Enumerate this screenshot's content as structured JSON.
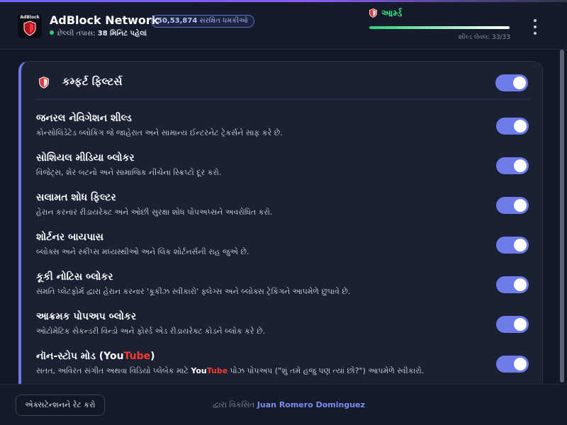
{
  "header": {
    "app_name": "AdBlock Network",
    "logo_text": "AdBlock",
    "blocked_count": "50,53,874",
    "blocked_label": "સંરક્ષિત ધમકીઓ",
    "last_check_label": "છેલ્લી તપાસ:",
    "last_check_value": "38 મિનિટ પહેલાં",
    "status": "આર્મ્ડ",
    "shield_level_text": "શીલ્ડ લેવલ: 33/33",
    "shield_level_fraction": 1.0,
    "colors": {
      "accent": "#6d7ce8",
      "armed": "#39e07f",
      "danger": "#e03a3a"
    }
  },
  "card": {
    "title": "કમ્ફર્ટ ફિલ્ટર્સ",
    "master_toggle_on": true,
    "filters": [
      {
        "title": "જનરલ નેવિગેશન શીલ્ડ",
        "description": "કોન્સોલિડેટેડ બ્લોકિંગ જે જાહેરાત અને સામાન્ય ઈન્ટરનેટ ટ્રેકર્સને સાફ કરે છે.",
        "enabled": true
      },
      {
        "title": "સોશિયલ મીડિયા બ્લોકર",
        "description": "વિજેટ્સ, શેર બટનો અને સામાજિક નીચેના સ્ક્રિપ્ટો દૂર કરો.",
        "enabled": true
      },
      {
        "title": "સલામત શોધ ફિલ્ટર",
        "description": "હેરાન કરનાર રીડાયરેક્ટ અને ઓછી સુરક્ષા શોધ પોપઅપ્સને અવરોધિત કરો.",
        "enabled": true
      },
      {
        "title": "શોર્ટનર બાયપાસ",
        "description": "બ્લોક્સ અને સ્કીપ્સ મધ્યસ્થીઓ અને લિંક શોર્ટનર્સની રાહ જુએ છે.",
        "enabled": true
      },
      {
        "title": "કૂકી નોટિસ બ્લોકર",
        "description": "સંમતિ પ્લેટફોર્મ દ્વારા હેરાન કરનાર 'કૂકીઝ સ્વીકારો' ફ્લેગ્સ અને બ્લોક્સ ટ્રેકિંગને આપમેળે છુપાવે છે.",
        "enabled": true
      },
      {
        "title": "આક્રમક પોપઅપ બ્લોકર",
        "description": "ઓટોમેટિક સેકન્ડરી વિન્ડો અને ફોર્સ્ડ એડ રીડાયરેક્ટ કોડને બ્લોક કરે છે.",
        "enabled": true
      }
    ],
    "nonstop": {
      "title_prefix": "નૉન-સ્ટોપ મોડ (",
      "title_you": "You",
      "title_tube": "Tube",
      "title_suffix": ")",
      "desc_prefix": "સતત, અવિરત સંગીત અથવા વિડિયો પ્લેબેક માટે ",
      "desc_you": "You",
      "desc_tube": "Tube",
      "desc_suffix": " પોઝ પોપઅપ (\"શું તમે હજુ પણ ત્યાં છો?\") આપમેળે સ્વીકારો.",
      "enabled": true
    }
  },
  "footer": {
    "rate_button": "એક્સટેન્શનને રેટ કરો",
    "developed_by": "દ્વારા વિકસિત",
    "developer_name": "Juan Romero Dominguez"
  }
}
